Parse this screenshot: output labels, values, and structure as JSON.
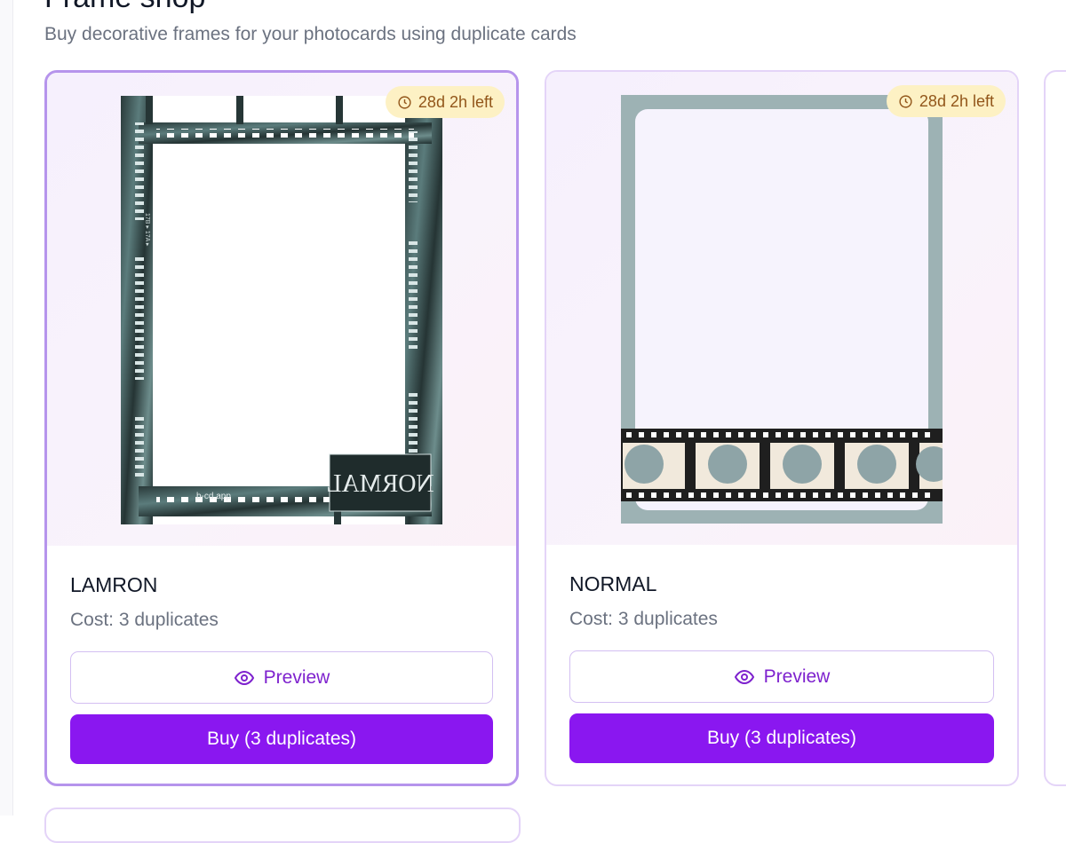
{
  "page": {
    "title": "Frame shop",
    "subtitle": "Buy decorative frames for your photocards using duplicate cards"
  },
  "colors": {
    "accent": "#8a17f0",
    "selected_border": "#b694ec",
    "card_border": "#e4d4f8",
    "badge_bg": "#fdf1c4",
    "badge_text": "#92561a"
  },
  "frames": [
    {
      "name": "LAMRON",
      "cost": "Cost: 3 duplicates",
      "time_left": "28d 2h left",
      "time_icon": "clock-icon",
      "preview_icon": "eye-icon",
      "preview_label": "Preview",
      "buy_label": "Buy (3 duplicates)",
      "selected": true,
      "art": {
        "watermark": "b-cd.app",
        "side_text": "17B ▸ 17A ▸",
        "logo_text": "NORMAL"
      }
    },
    {
      "name": "NORMAL",
      "cost": "Cost: 3 duplicates",
      "time_left": "28d 2h left",
      "time_icon": "clock-icon",
      "preview_icon": "eye-icon",
      "preview_label": "Preview",
      "buy_label": "Buy (3 duplicates)",
      "selected": false
    }
  ]
}
